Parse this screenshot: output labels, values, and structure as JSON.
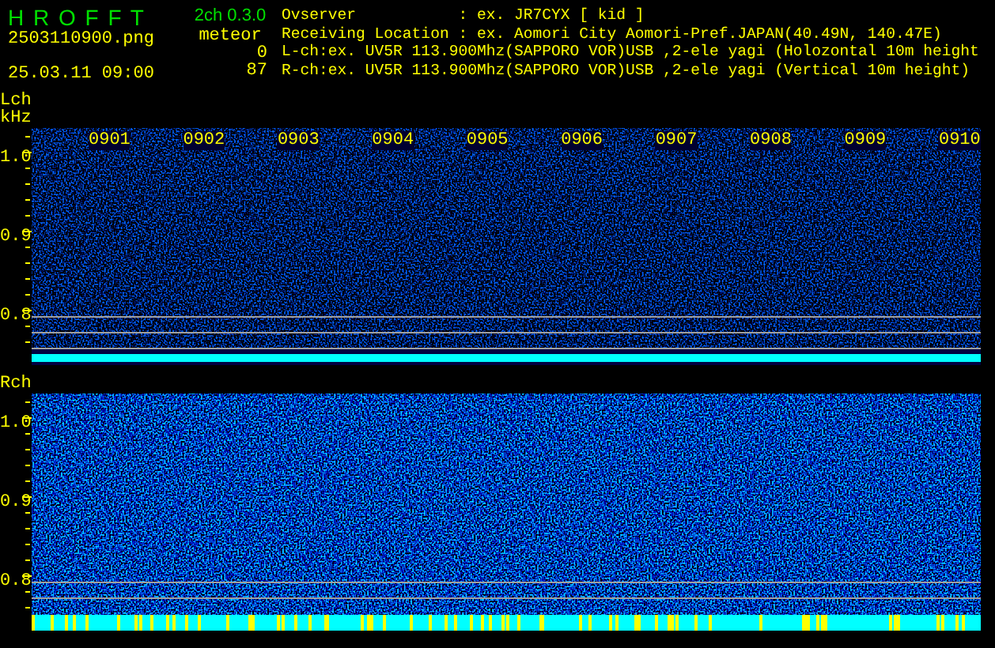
{
  "header": {
    "app_title": "H R O F F T",
    "file_name": "2503110900.png",
    "date_time": "25.03.11 09:00",
    "version": "2ch 0.3.0",
    "counter_label": "meteor",
    "counts": [
      "0",
      "87"
    ],
    "info_lines": [
      "Ovserver           : ex. JR7CYX [ kid ]",
      "Receiving Location : ex. Aomori City Aomori-Pref.JAPAN(40.49N, 140.47E)",
      "L-ch:ex. UV5R 113.900Mhz(SAPPORO VOR)USB ,2-ele yagi (Holozontal 10m height",
      "R-ch:ex. UV5R 113.900Mhz(SAPPORO VOR)USB ,2-ele yagi (Vertical 10m height)"
    ]
  },
  "panels": [
    {
      "kind": "lch",
      "label": "Lch",
      "unit": "kHz",
      "yticks": [
        "1.0",
        "0.9",
        "0.8"
      ],
      "time_labels": [
        "0901",
        "0902",
        "0903",
        "0904",
        "0905",
        "0906",
        "0907",
        "0908",
        "0909",
        "0910"
      ]
    },
    {
      "kind": "rch",
      "label": "Rch",
      "yticks": [
        "1.0",
        "0.9",
        "0.8"
      ]
    }
  ]
}
